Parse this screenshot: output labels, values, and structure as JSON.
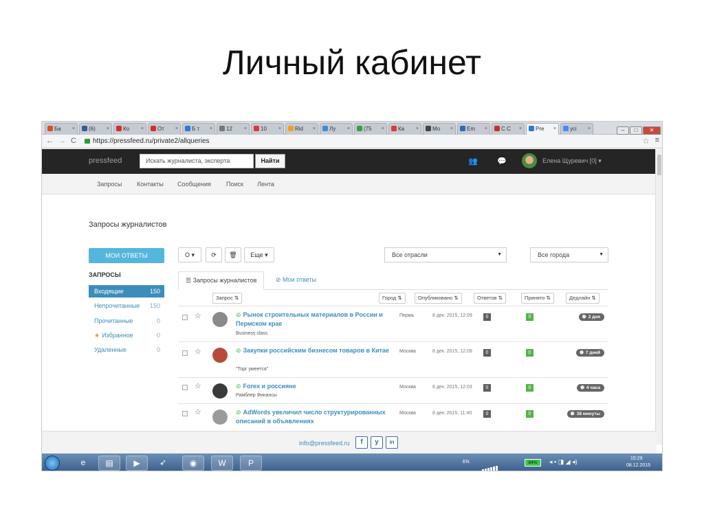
{
  "slide_title": "Личный кабинет",
  "browser": {
    "tabs": [
      {
        "label": "Ба",
        "color": "#d6502c"
      },
      {
        "label": "(6)",
        "color": "#3b5998"
      },
      {
        "label": "Ко",
        "color": "#d32f2f"
      },
      {
        "label": "От",
        "color": "#d32f2f"
      },
      {
        "label": "Б т",
        "color": "#2a7ad6"
      },
      {
        "label": "12",
        "color": "#777777"
      },
      {
        "label": "10",
        "color": "#d63c3c"
      },
      {
        "label": "Rid",
        "color": "#f0a020"
      },
      {
        "label": "Лу",
        "color": "#3b8ed6"
      },
      {
        "label": "(75",
        "color": "#3a9d4a"
      },
      {
        "label": "Ка",
        "color": "#d63c3c"
      },
      {
        "label": "Мо",
        "color": "#444444"
      },
      {
        "label": "Em",
        "color": "#2a6db5"
      },
      {
        "label": "С С",
        "color": "#c0302c"
      },
      {
        "label": "Pre",
        "color": "#2a7ad6"
      },
      {
        "label": "усі",
        "color": "#4a8af4"
      }
    ],
    "url": "https://pressfeed.ru/private2/allqueries"
  },
  "site": {
    "logo": "pressfeed",
    "search_placeholder": "Искать журналиста, эксперта",
    "search_button": "Найти",
    "user_name": "Елена Щуревич [0] ▾",
    "menu": [
      "Запросы",
      "Контакты",
      "Сообщения",
      "Поиск",
      "Лента"
    ]
  },
  "page": {
    "heading": "Запросы журналистов",
    "my_answers_button": "МОИ ОТВЕТЫ",
    "sidebar_title": "ЗАПРОСЫ",
    "sidebar_items": [
      {
        "label": "Входящие",
        "count": "150"
      },
      {
        "label": "Непрочитанные",
        "count": "150"
      },
      {
        "label": "Прочитанные",
        "count": "0"
      },
      {
        "label": "Избранное",
        "count": "0"
      },
      {
        "label": "Удаленные",
        "count": "0"
      }
    ],
    "toolbar": {
      "more": "Еще ▾",
      "industry": "Все отрасли",
      "city": "Все города"
    },
    "tabs": [
      "Запросы журналистов",
      "Мои ответы"
    ],
    "columns": [
      "Запрос",
      "Город",
      "Опубликовано",
      "Ответов",
      "Принято",
      "Дедлайн"
    ],
    "rows": [
      {
        "title": "Рынок строительных материалов в России и Пермском крае",
        "source": "Business class",
        "city": "Пермь",
        "date": "8 дек. 2015, 12:09",
        "answers": "0",
        "accepted": "0",
        "deadline": "2 дня",
        "avatar": "#8a8a8a"
      },
      {
        "title": "Закупки российским бизнесом товаров в Китае",
        "source": "\"Торг умеется\"",
        "city": "Москва",
        "date": "8 дек. 2015, 12:09",
        "answers": "0",
        "accepted": "0",
        "deadline": "7 дней",
        "avatar": "#b84a3c"
      },
      {
        "title": "Forex и россияне",
        "source": "Рамблер Финансы",
        "city": "Москва",
        "date": "8 дек. 2015, 12:03",
        "answers": "0",
        "accepted": "0",
        "deadline": "4 часа",
        "avatar": "#3a3a3a"
      },
      {
        "title": "AdWords увеличил число структурированных описаний в объявлениях",
        "source": "",
        "city": "Москва",
        "date": "8 дек. 2015, 11:40",
        "answers": "0",
        "accepted": "0",
        "deadline": "38 минуты",
        "avatar": "#9a9a9a"
      }
    ],
    "footer_email": "info@pressfeed.ru",
    "social": [
      "f",
      "y",
      "in"
    ]
  },
  "taskbar": {
    "lang": "EN",
    "battery": "84%",
    "time": "15:29",
    "date": "08.12.2015"
  }
}
